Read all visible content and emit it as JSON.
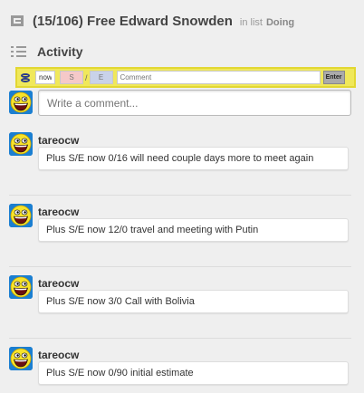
{
  "card": {
    "title": "(15/106) Free Edward Snowden",
    "in_list_label": "in list",
    "list_name": "Doing"
  },
  "activity": {
    "title": "Activity"
  },
  "plugin_bar": {
    "time_value": "now",
    "spent_placeholder": "S",
    "separator": "/",
    "estimate_placeholder": "E",
    "comment_placeholder": "Comment",
    "enter_label": "Enter",
    "highlight_color": "#f0e85a"
  },
  "new_comment": {
    "placeholder": "Write a comment..."
  },
  "comments": [
    {
      "author": "tareocw",
      "text": "Plus S/E now 0/16 will need couple days more to meet again"
    },
    {
      "author": "tareocw",
      "text": "Plus S/E now 12/0 travel and meeting with Putin"
    },
    {
      "author": "tareocw",
      "text": "Plus S/E now 3/0 Call with Bolivia"
    },
    {
      "author": "tareocw",
      "text": "Plus S/E now 0/90 initial estimate"
    }
  ],
  "icons": {
    "card": "card-icon",
    "activity": "activity-list-icon",
    "plugin": "hourglass-icon",
    "avatar": "awesome-face-avatar"
  }
}
